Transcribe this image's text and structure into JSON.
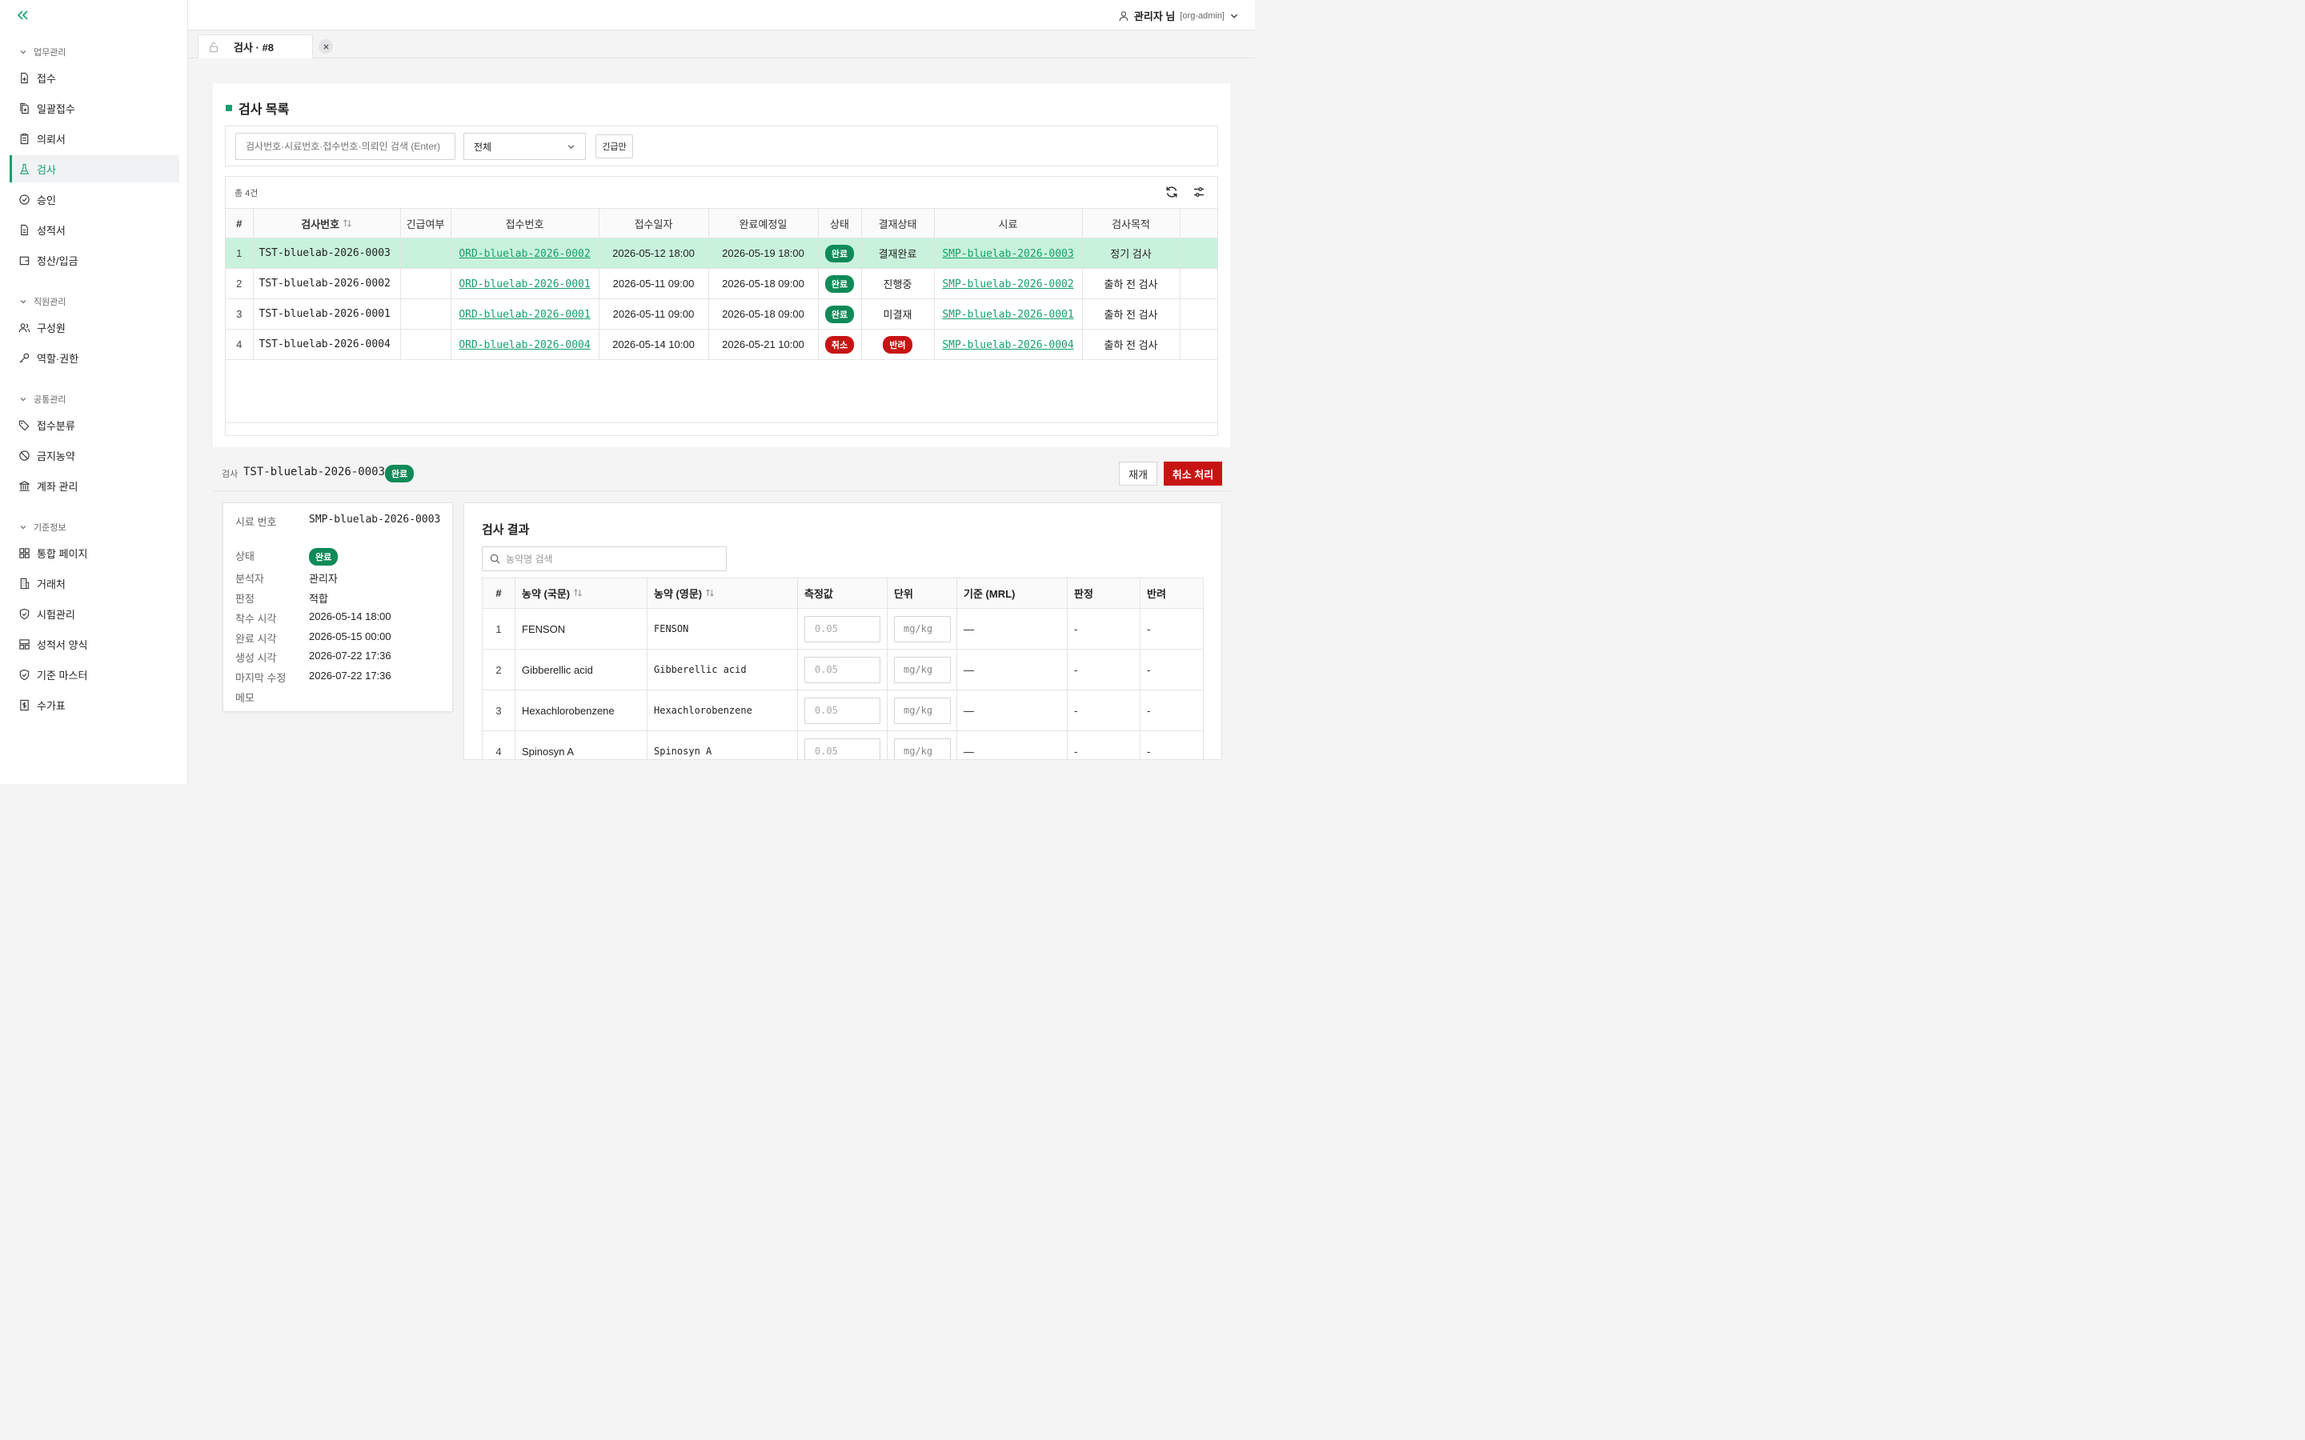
{
  "sidebar": {
    "groups": [
      {
        "title": "업무관리",
        "items": [
          {
            "label": "접수",
            "icon": "file-plus-icon"
          },
          {
            "label": "일괄접수",
            "icon": "files-plus-icon"
          },
          {
            "label": "의뢰서",
            "icon": "clipboard-icon"
          },
          {
            "label": "검사",
            "icon": "flask-icon",
            "active": true
          },
          {
            "label": "승인",
            "icon": "check-circle-icon"
          },
          {
            "label": "성적서",
            "icon": "document-icon"
          },
          {
            "label": "정산/입금",
            "icon": "wallet-icon"
          }
        ]
      },
      {
        "title": "직원관리",
        "items": [
          {
            "label": "구성원",
            "icon": "users-icon"
          },
          {
            "label": "역할·권한",
            "icon": "key-icon"
          }
        ]
      },
      {
        "title": "공통관리",
        "items": [
          {
            "label": "접수분류",
            "icon": "tags-icon"
          },
          {
            "label": "금지농약",
            "icon": "ban-icon"
          },
          {
            "label": "계좌 관리",
            "icon": "bank-icon"
          }
        ]
      },
      {
        "title": "기준정보",
        "items": [
          {
            "label": "통합 페이지",
            "icon": "grid-icon"
          },
          {
            "label": "거래처",
            "icon": "building-icon"
          },
          {
            "label": "시험관리",
            "icon": "shield-check-icon"
          },
          {
            "label": "성적서 양식",
            "icon": "layout-icon"
          },
          {
            "label": "기준 마스터",
            "icon": "shield-icon"
          },
          {
            "label": "수가표",
            "icon": "price-list-icon"
          }
        ]
      }
    ]
  },
  "header": {
    "user_name": "관리자 님",
    "user_role": "[org-admin]"
  },
  "tabs": [
    {
      "label": "검사 · #8"
    }
  ],
  "list": {
    "title": "검사 목록",
    "search_placeholder": "검사번호·시료번호·접수번호·의뢰인 검색 (Enter)",
    "filter_value": "전체",
    "urgent_label": "긴급만",
    "count_text": "총 4건",
    "columns": [
      "#",
      "검사번호",
      "긴급여부",
      "접수번호",
      "접수일자",
      "완료예정일",
      "상태",
      "결재상태",
      "시료",
      "검사목적"
    ],
    "rows": [
      {
        "no": "1",
        "test_no": "TST-bluelab-2026-0003",
        "urgent": "",
        "order_no": "ORD-bluelab-2026-0002",
        "received": "2026-05-12 18:00",
        "due": "2026-05-19 18:00",
        "status": "완료",
        "approval": "결재완료",
        "sample": "SMP-bluelab-2026-0003",
        "purpose": "정기 검사"
      },
      {
        "no": "2",
        "test_no": "TST-bluelab-2026-0002",
        "urgent": "",
        "order_no": "ORD-bluelab-2026-0001",
        "received": "2026-05-11 09:00",
        "due": "2026-05-18 09:00",
        "status": "완료",
        "approval": "진행중",
        "sample": "SMP-bluelab-2026-0002",
        "purpose": "출하 전 검사"
      },
      {
        "no": "3",
        "test_no": "TST-bluelab-2026-0001",
        "urgent": "",
        "order_no": "ORD-bluelab-2026-0001",
        "received": "2026-05-11 09:00",
        "due": "2026-05-18 09:00",
        "status": "완료",
        "approval": "미결재",
        "sample": "SMP-bluelab-2026-0001",
        "purpose": "출하 전 검사"
      },
      {
        "no": "4",
        "test_no": "TST-bluelab-2026-0004",
        "urgent": "",
        "order_no": "ORD-bluelab-2026-0004",
        "received": "2026-05-14 10:00",
        "due": "2026-05-21 10:00",
        "status": "취소",
        "approval": "반려",
        "sample": "SMP-bluelab-2026-0004",
        "purpose": "출하 전 검사"
      }
    ]
  },
  "detail": {
    "label": "검사",
    "test_no": "TST-bluelab-2026-0003",
    "status": "완료",
    "resume_label": "재개",
    "cancel_label": "취소 처리",
    "info": [
      {
        "label": "시료 번호",
        "value": "SMP-bluelab-2026-0003"
      },
      {
        "label": "상태",
        "value": "완료"
      },
      {
        "label": "분석자",
        "value": "관리자"
      },
      {
        "label": "판정",
        "value": "적합"
      },
      {
        "label": "착수 시각",
        "value": "2026-05-14 18:00"
      },
      {
        "label": "완료 시각",
        "value": "2026-05-15 00:00"
      },
      {
        "label": "생성 시각",
        "value": "2026-07-22 17:36"
      },
      {
        "label": "마지막 수정",
        "value": "2026-07-22 17:36"
      },
      {
        "label": "메모",
        "value": ""
      }
    ]
  },
  "results": {
    "title": "검사 결과",
    "search_placeholder": "농약명 검색",
    "columns": [
      "#",
      "농약 (국문)",
      "농약 (영문)",
      "측정값",
      "단위",
      "기준 (MRL)",
      "판정",
      "반려"
    ],
    "rows": [
      {
        "no": "1",
        "kr": "FENSON",
        "en": "FENSON",
        "measure_ph": "0.05",
        "unit_ph": "mg/kg",
        "mrl": "—",
        "verdict": "-",
        "reject": "-"
      },
      {
        "no": "2",
        "kr": "Gibberellic acid",
        "en": "Gibberellic acid",
        "measure_ph": "0.05",
        "unit_ph": "mg/kg",
        "mrl": "—",
        "verdict": "-",
        "reject": "-"
      },
      {
        "no": "3",
        "kr": "Hexachlorobenzene",
        "en": "Hexachlorobenzene",
        "measure_ph": "0.05",
        "unit_ph": "mg/kg",
        "mrl": "—",
        "verdict": "-",
        "reject": "-"
      },
      {
        "no": "4",
        "kr": "Spinosyn A",
        "en": "Spinosyn A",
        "measure_ph": "0.05",
        "unit_ph": "mg/kg",
        "mrl": "—",
        "verdict": "-",
        "reject": "-"
      }
    ]
  },
  "colors": {
    "accent": "#16a06b",
    "danger": "#c81313",
    "selected_row": "#c9f2dc"
  }
}
